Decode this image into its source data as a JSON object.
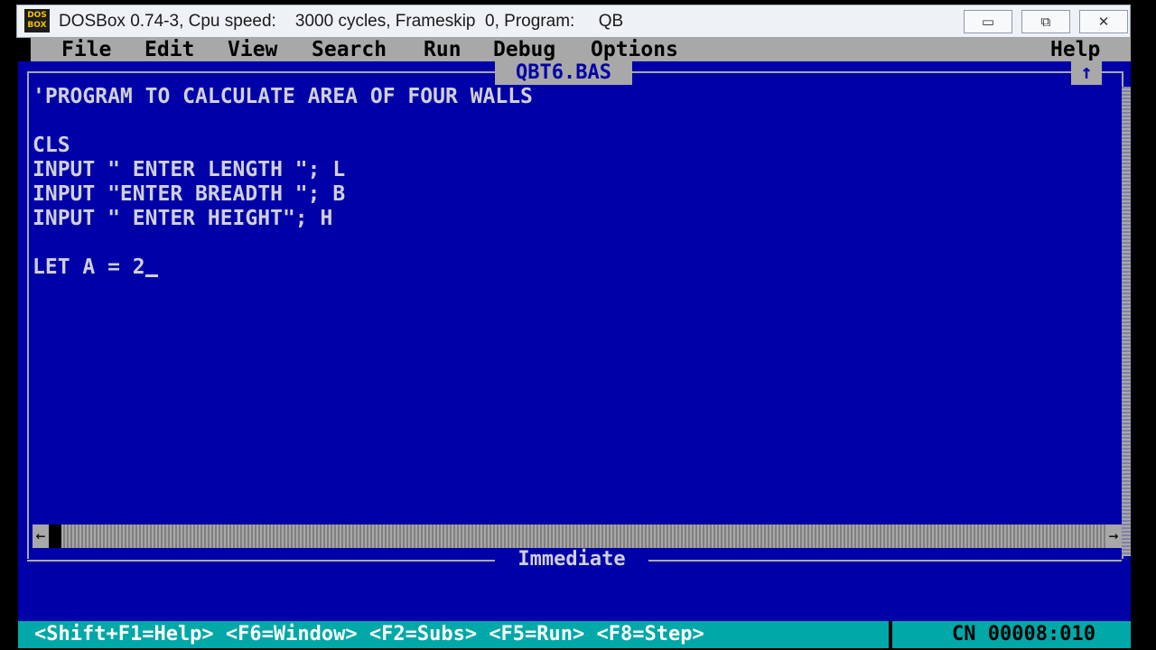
{
  "window": {
    "icon_label": "DOS BOX",
    "title": "DOSBox 0.74-3, Cpu speed:    3000 cycles, Frameskip  0, Program:     QB",
    "min_symbol": "▭",
    "max_symbol": "⧉",
    "close_symbol": "✕"
  },
  "menu": {
    "items": [
      "File",
      "Edit",
      "View",
      "Search",
      "Run",
      "Debug",
      "Options"
    ],
    "help": "Help"
  },
  "editor": {
    "filename": "QBT6.BAS",
    "maximize_symbol": "↑",
    "lines": [
      "'PROGRAM TO CALCULATE AREA OF FOUR WALLS",
      "",
      "CLS",
      "INPUT \" ENTER LENGTH \"; L",
      "INPUT \"ENTER BREADTH \"; B",
      "INPUT \" ENTER HEIGHT\"; H",
      "",
      "LET A = 2"
    ],
    "hscroll_left": "←",
    "hscroll_right": "→"
  },
  "immediate": {
    "title": "Immediate"
  },
  "status": {
    "shortcuts": "<Shift+F1=Help> <F6=Window> <F2=Subs> <F5=Run> <F8=Step>",
    "position": "CN 00008:010"
  }
}
